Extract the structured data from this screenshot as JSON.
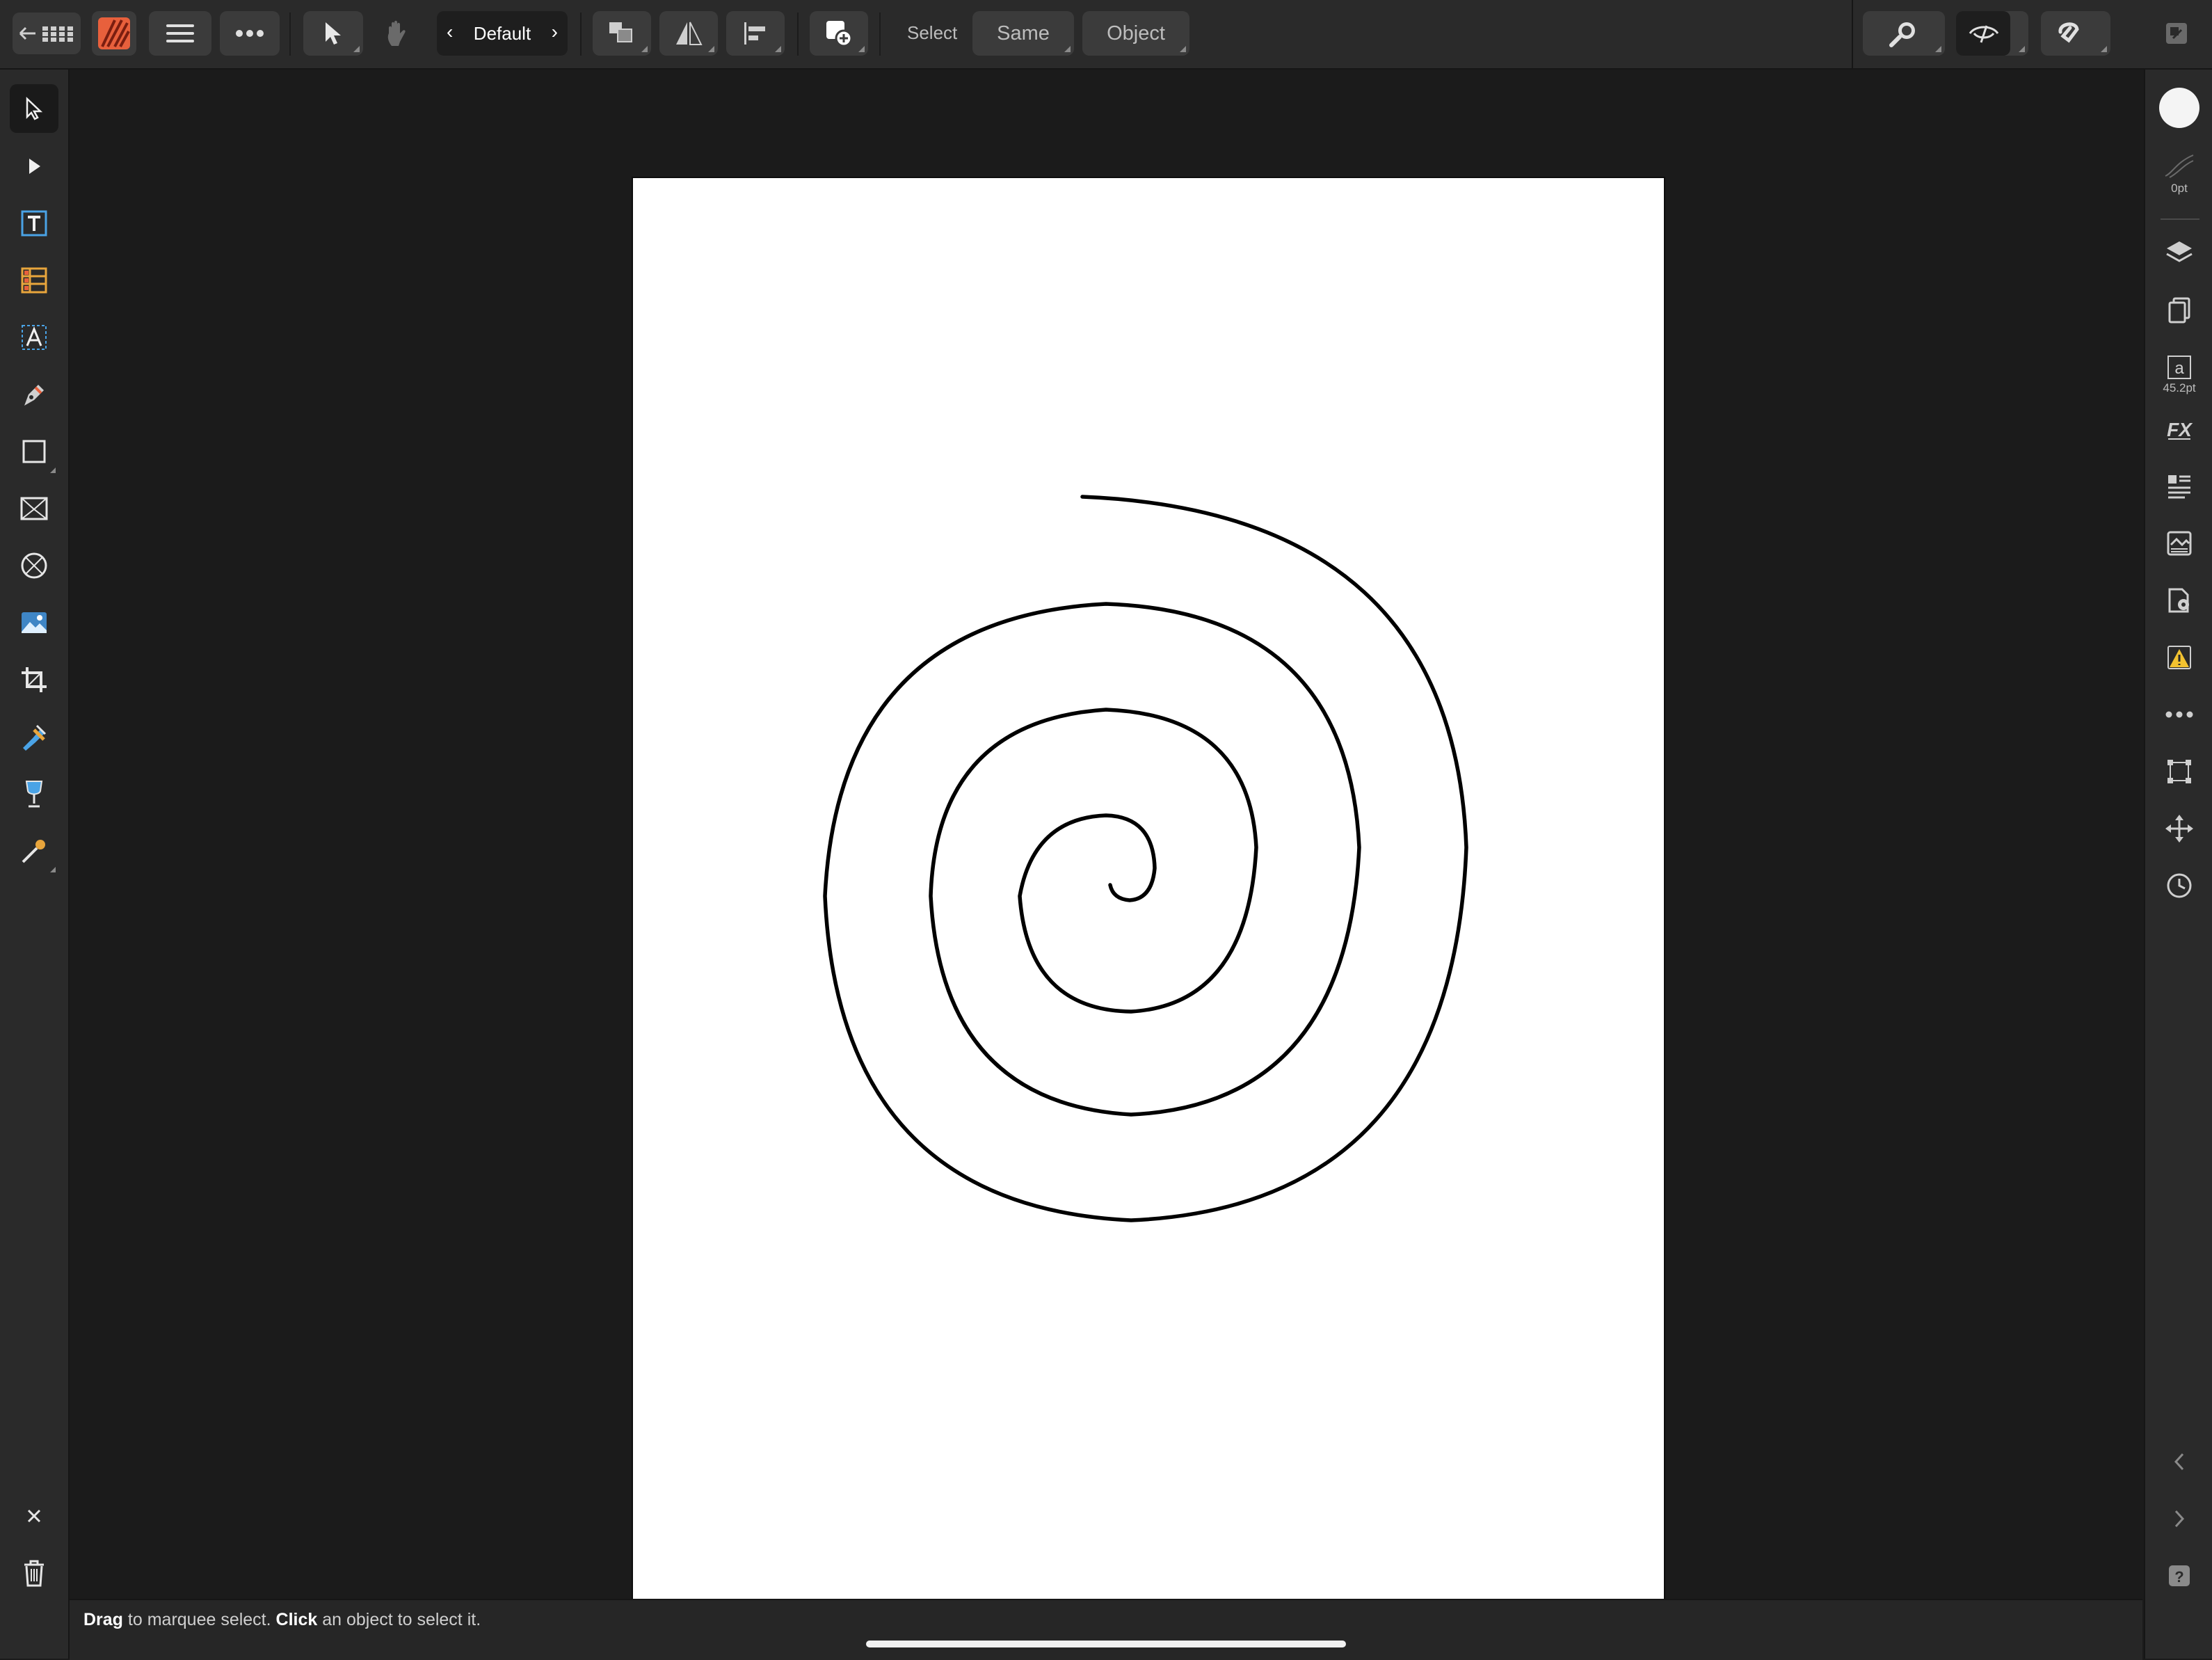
{
  "toolbar": {
    "persona_label": "Default",
    "select_label": "Select",
    "same_label": "Same",
    "object_label": "Object"
  },
  "left_tools": [
    "move-tool",
    "node-tool",
    "frame-text-tool",
    "table-tool",
    "artistic-text-tool",
    "pen-tool",
    "rectangle-tool",
    "picture-frame-rectangle-tool",
    "picture-frame-ellipse-tool",
    "place-image-tool",
    "crop-tool",
    "fill-tool",
    "transparency-tool",
    "color-picker-tool"
  ],
  "right_studio": {
    "stroke_width": "0pt",
    "text_size": "45.2pt"
  },
  "status": {
    "drag": "Drag",
    "drag_rest": " to marquee select. ",
    "click": "Click",
    "click_rest": " an object to select it."
  },
  "colors": {
    "ui_background": "#2a2a2a",
    "canvas_background": "#1b1b1b",
    "page": "#ffffff",
    "spiral_stroke": "#000000",
    "brand_orange": "#e8603c"
  },
  "canvas": {
    "shape": "spiral",
    "stroke_color": "#000000"
  }
}
